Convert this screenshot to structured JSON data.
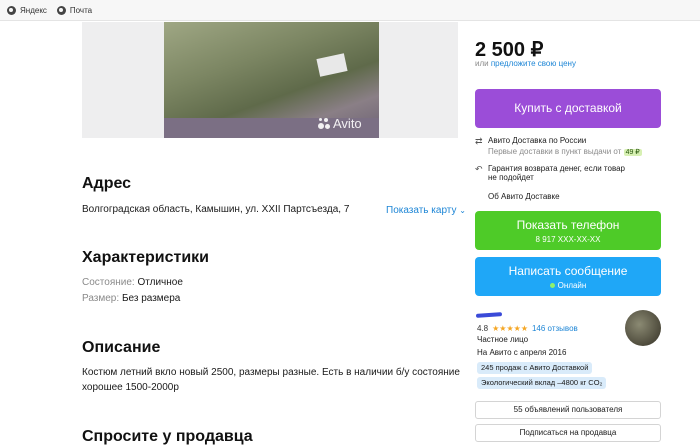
{
  "bookmarks": [
    {
      "label": "Яндекс",
      "icon": "globe-icon"
    },
    {
      "label": "Почта",
      "icon": "globe-icon"
    }
  ],
  "photo": {
    "watermark": "Avito"
  },
  "address": {
    "title": "Адрес",
    "text": "Волгоградская область, Камышин, ул. XXII Партсъезда, 7",
    "map_link": "Показать карту"
  },
  "characteristics": {
    "title": "Характеристики",
    "rows": [
      {
        "label": "Состояние:",
        "value": "Отличное"
      },
      {
        "label": "Размер:",
        "value": "Без размера"
      }
    ]
  },
  "description": {
    "title": "Описание",
    "line1": "Костюм летний вкло новый 2500, размеры разные. Есть в наличии б/у состояние",
    "line2": "хорошее 1500-2000р"
  },
  "ask_seller_title": "Спросите у продавца",
  "price": {
    "value": "2 500 ₽",
    "or": "или",
    "offer_link": "предложите свою цену"
  },
  "buttons": {
    "buy": "Купить с доставкой",
    "phone": "Показать телефон",
    "phone_number": "8 917 XXX-XX-XX",
    "message": "Написать сообщение",
    "online": "Онлайн"
  },
  "delivery": {
    "title": "Авито Доставка по России",
    "subtitle": "Первые доставки в пункт выдачи от",
    "badge": "49 ₽",
    "guarantee_line1": "Гарантия возврата денег, если товар",
    "guarantee_line2": "не подойдет",
    "about_link": "Об Авито Доставке"
  },
  "seller": {
    "rating": "4.8",
    "stars": "★★★★★",
    "reviews": "146 отзывов",
    "type": "Частное лицо",
    "since": "На Авито с апреля 2016",
    "badges": [
      "245 продаж с Авито Доставкой",
      "Экологический вклад –4800 кг CO₂"
    ],
    "listings_button": "55 объявлений пользователя",
    "subscribe_button": "Подписаться на продавца"
  },
  "colors": {
    "buy": "#9b4dd8",
    "phone": "#4ecb28",
    "message": "#1fa7f7",
    "link": "#1e86d6"
  }
}
